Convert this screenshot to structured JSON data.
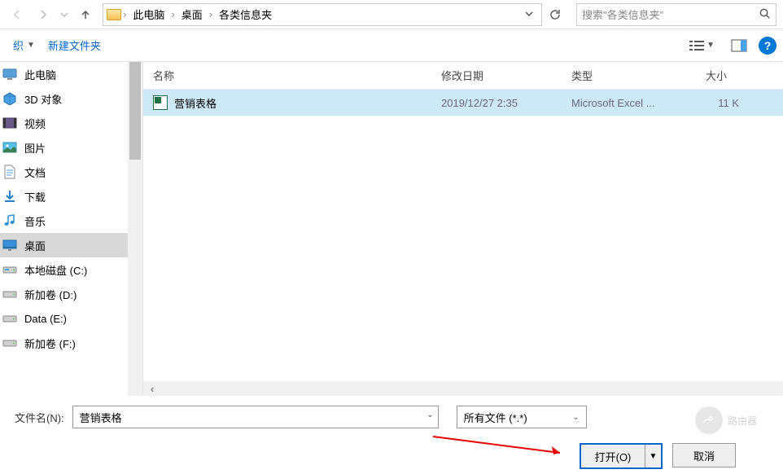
{
  "nav": {
    "breadcrumb": [
      "此电脑",
      "桌面",
      "各类信息夹"
    ]
  },
  "search": {
    "placeholder": "搜索\"各类信息夹\""
  },
  "toolbar": {
    "organize_label": "织",
    "new_folder_label": "新建文件夹"
  },
  "sidebar": {
    "items": [
      {
        "label": "此电脑",
        "icon": "pc"
      },
      {
        "label": "3D 对象",
        "icon": "3d"
      },
      {
        "label": "视频",
        "icon": "video"
      },
      {
        "label": "图片",
        "icon": "picture"
      },
      {
        "label": "文档",
        "icon": "doc"
      },
      {
        "label": "下载",
        "icon": "download"
      },
      {
        "label": "音乐",
        "icon": "music"
      },
      {
        "label": "桌面",
        "icon": "desktop",
        "selected": true
      },
      {
        "label": "本地磁盘 (C:)",
        "icon": "drive-c"
      },
      {
        "label": "新加卷 (D:)",
        "icon": "drive"
      },
      {
        "label": "Data (E:)",
        "icon": "drive"
      },
      {
        "label": "新加卷 (F:)",
        "icon": "drive"
      }
    ]
  },
  "file_header": {
    "name": "名称",
    "date": "修改日期",
    "type": "类型",
    "size": "大小"
  },
  "files": [
    {
      "name": "营销表格",
      "date": "2019/12/27 2:35",
      "type": "Microsoft Excel ...",
      "size": "11 K",
      "selected": true
    }
  ],
  "bottom": {
    "filename_label": "文件名(N):",
    "filename_value": "营销表格",
    "filter_label": "所有文件 (*.*)",
    "open_label": "打开(O)",
    "cancel_label": "取消"
  },
  "watermark": {
    "text": "路由器"
  }
}
